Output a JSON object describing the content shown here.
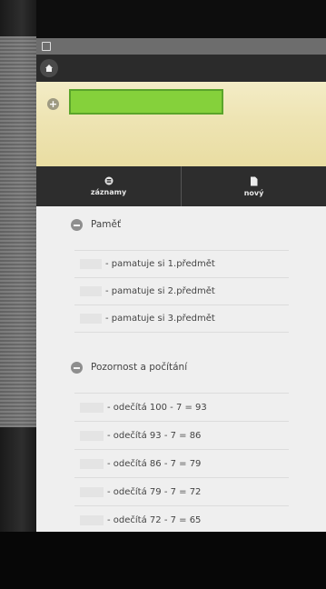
{
  "toolbar": {
    "name_field_value": "",
    "tabs": [
      {
        "label": "záznamy",
        "icon": "list-icon"
      },
      {
        "label": "nový",
        "icon": "document-icon"
      }
    ]
  },
  "sections": [
    {
      "title": "Paměť",
      "items": [
        "- pamatuje si 1.předmět",
        "- pamatuje si 2.předmět",
        "- pamatuje si 3.předmět"
      ]
    },
    {
      "title": "Pozornost a počítání",
      "items": [
        "- odečítá 100 - 7 = 93",
        "- odečítá 93 - 7 = 86",
        "- odečítá 86 - 7 = 79",
        "- odečítá 79 - 7 = 72",
        "- odečítá 72 - 7 = 65"
      ]
    }
  ],
  "colors": {
    "accent_green": "#85d13b",
    "topbar": "#2b2b2b",
    "highlight_yellow": "#eee4b3"
  }
}
